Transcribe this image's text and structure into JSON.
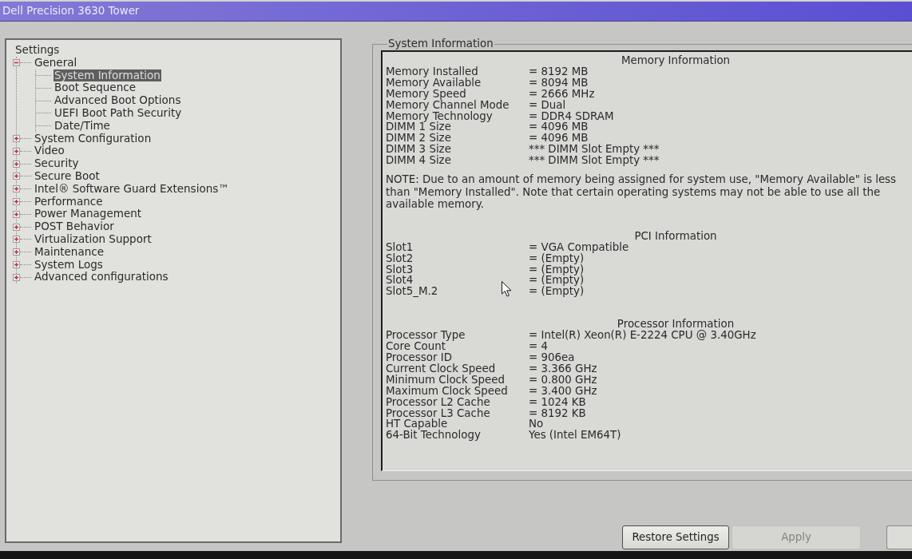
{
  "window": {
    "title": "Dell Precision 3630 Tower"
  },
  "tree": {
    "root": "Settings",
    "items": [
      {
        "label": "General",
        "expanded": true,
        "selected": false,
        "children": [
          {
            "label": "System Information",
            "selected": true
          },
          {
            "label": "Boot Sequence",
            "selected": false
          },
          {
            "label": "Advanced Boot Options",
            "selected": false
          },
          {
            "label": "UEFI Boot Path Security",
            "selected": false
          },
          {
            "label": "Date/Time",
            "selected": false
          }
        ]
      },
      {
        "label": "System Configuration",
        "expanded": false,
        "selected": false
      },
      {
        "label": "Video",
        "expanded": false,
        "selected": false
      },
      {
        "label": "Security",
        "expanded": false,
        "selected": false
      },
      {
        "label": "Secure Boot",
        "expanded": false,
        "selected": false
      },
      {
        "label": "Intel® Software Guard Extensions™",
        "expanded": false,
        "selected": false
      },
      {
        "label": "Performance",
        "expanded": false,
        "selected": false
      },
      {
        "label": "Power Management",
        "expanded": false,
        "selected": false
      },
      {
        "label": "POST Behavior",
        "expanded": false,
        "selected": false
      },
      {
        "label": "Virtualization Support",
        "expanded": false,
        "selected": false
      },
      {
        "label": "Maintenance",
        "expanded": false,
        "selected": false
      },
      {
        "label": "System Logs",
        "expanded": false,
        "selected": false
      },
      {
        "label": "Advanced configurations",
        "expanded": false,
        "selected": false
      }
    ]
  },
  "panel": {
    "title": "System Information",
    "sections": [
      {
        "heading": "Memory Information",
        "rows": [
          {
            "label": "Memory Installed",
            "value": "= 8192 MB"
          },
          {
            "label": "Memory Available",
            "value": "= 8094 MB"
          },
          {
            "label": "Memory Speed",
            "value": "= 2666 MHz"
          },
          {
            "label": "Memory Channel Mode",
            "value": "= Dual"
          },
          {
            "label": "Memory Technology",
            "value": "= DDR4 SDRAM"
          },
          {
            "label": "DIMM 1 Size",
            "value": "= 4096 MB"
          },
          {
            "label": "DIMM 2 Size",
            "value": "= 4096 MB"
          },
          {
            "label": "DIMM 3 Size",
            "value": "*** DIMM Slot Empty ***"
          },
          {
            "label": "DIMM 4 Size",
            "value": "*** DIMM Slot Empty ***"
          }
        ],
        "note": "NOTE: Due to an amount of memory being assigned for system use, \"Memory Available\" is less than \"Memory Installed\". Note that certain operating systems may not be able to use all the available memory."
      },
      {
        "heading": "PCI Information",
        "rows": [
          {
            "label": "Slot1",
            "value": "= VGA Compatible"
          },
          {
            "label": "Slot2",
            "value": "= (Empty)"
          },
          {
            "label": "Slot3",
            "value": "= (Empty)"
          },
          {
            "label": "Slot4",
            "value": "= (Empty)"
          },
          {
            "label": "Slot5_M.2",
            "value": "= (Empty)"
          }
        ]
      },
      {
        "heading": "Processor Information",
        "rows": [
          {
            "label": "Processor Type",
            "value": "= Intel(R) Xeon(R) E-2224 CPU @ 3.40GHz"
          },
          {
            "label": "Core Count",
            "value": "= 4"
          },
          {
            "label": "Processor ID",
            "value": "= 906ea"
          },
          {
            "label": "Current Clock Speed",
            "value": "= 3.366 GHz"
          },
          {
            "label": "Minimum Clock Speed",
            "value": "= 0.800 GHz"
          },
          {
            "label": "Maximum Clock Speed",
            "value": "= 3.400 GHz"
          },
          {
            "label": "Processor L2 Cache",
            "value": "= 1024 KB"
          },
          {
            "label": "Processor L3 Cache",
            "value": "= 8192 KB"
          },
          {
            "label": "HT Capable",
            "value": "No"
          },
          {
            "label": "64-Bit Technology",
            "value": "Yes (Intel EM64T)"
          }
        ]
      }
    ]
  },
  "buttons": [
    {
      "label": "Restore Settings",
      "disabled": false
    },
    {
      "label": "Apply",
      "disabled": true
    }
  ]
}
